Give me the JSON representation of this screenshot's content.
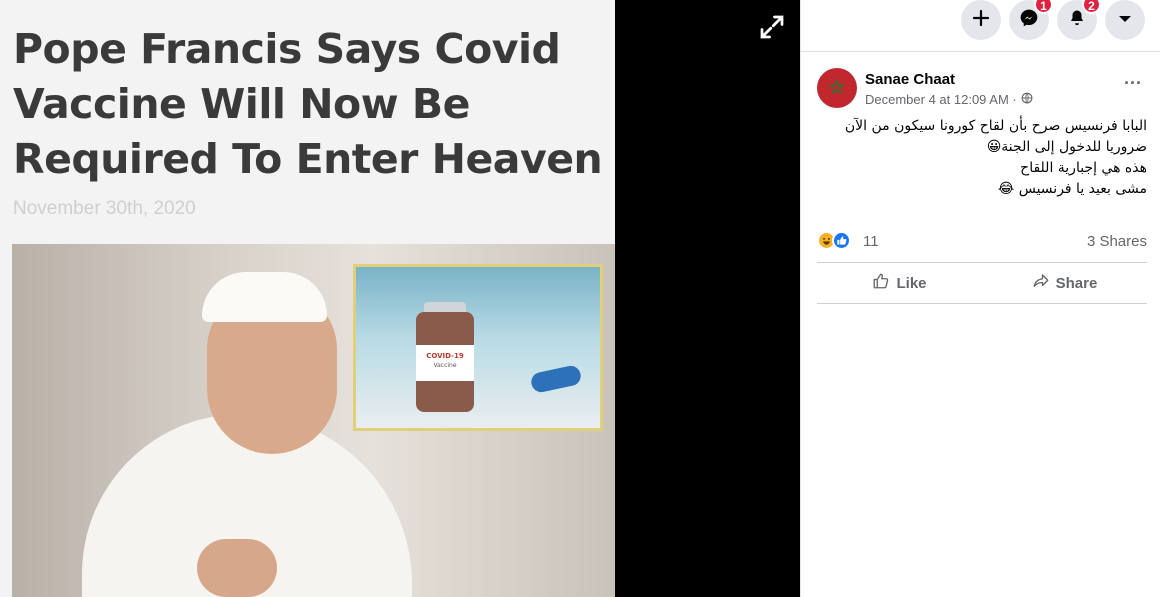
{
  "media": {
    "headline": "Pope Francis Says Covid Vaccine Will Now Be Required To Enter Heaven",
    "date": "November 30th, 2020",
    "vial_label_title": "COVID-19",
    "vial_label_sub": "Vaccine"
  },
  "topbar": {
    "icons": [
      "plus-icon",
      "messenger-icon",
      "bell-icon",
      "caret-down-icon"
    ],
    "messenger_badge": "1",
    "notifications_badge": "2"
  },
  "post": {
    "author": "Sanae Chaat",
    "timestamp": "December 4 at 12:09 AM · ",
    "privacy_icon": "globe-icon",
    "text_lines": [
      "البابا فرنسيس صرح بأن لقاح كورونا سيكون من الآن",
      "ضروريا للدخول إلى الجنة😀",
      "هذه هي إجبارية اللقاح",
      "مشى بعيد يا فرنسيس 😂"
    ],
    "reaction_count": "11",
    "shares": "3 Shares",
    "like_label": "Like",
    "share_label": "Share"
  },
  "colors": {
    "accent": "#1877f2",
    "badge": "#e41e3f",
    "avatar": "#c1272d",
    "haha": "#f7b125"
  }
}
